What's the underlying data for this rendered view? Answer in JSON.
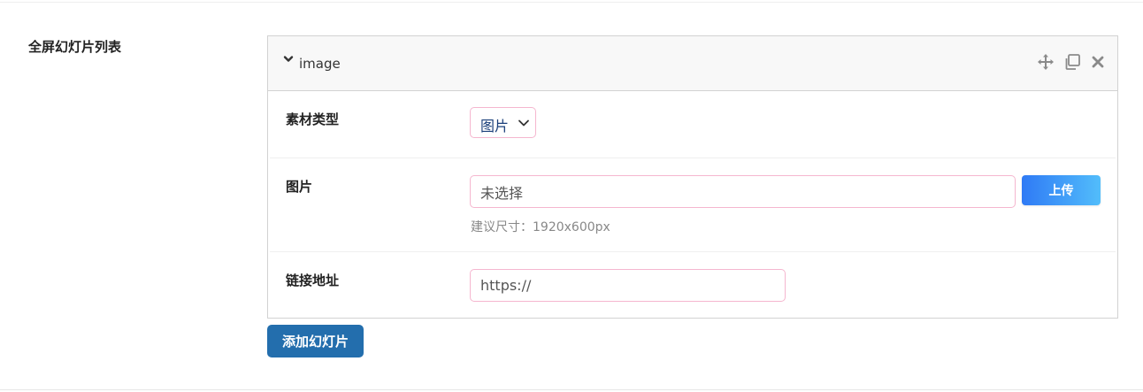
{
  "section": {
    "label": "全屏幻灯片列表"
  },
  "panel": {
    "title": "image",
    "icons": {
      "collapse": "chevron-down-icon",
      "move": "move-icon",
      "copy": "copy-icon",
      "close": "close-icon"
    }
  },
  "fields": {
    "material_type": {
      "label": "素材类型",
      "value": "图片"
    },
    "image": {
      "label": "图片",
      "value": "未选择",
      "upload_label": "上传",
      "hint": "建议尺寸：1920x600px"
    },
    "link": {
      "label": "链接地址",
      "value": "https://"
    }
  },
  "actions": {
    "add_slide_label": "添加幻灯片"
  },
  "colors": {
    "add_button": "#236ead",
    "upload_start": "#2f7af5",
    "upload_end": "#52bdfb",
    "input_border": "#f5b6cf"
  }
}
